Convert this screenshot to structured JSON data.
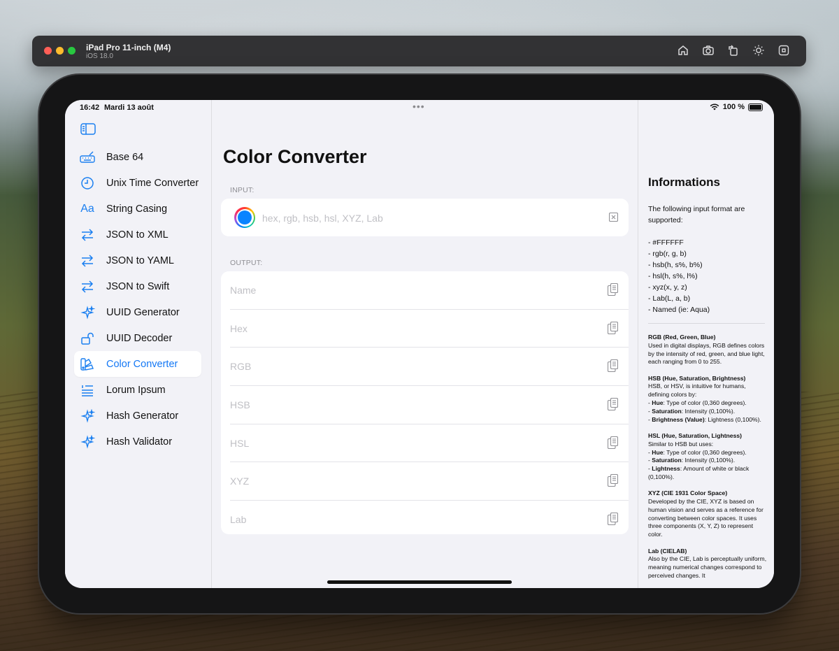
{
  "simulator": {
    "device": "iPad Pro 11-inch (M4)",
    "os": "iOS 18.0",
    "tools": [
      "home-icon",
      "screenshot-icon",
      "rotate-icon",
      "appearance-icon",
      "command-icon"
    ]
  },
  "status_bar": {
    "time": "16:42",
    "date": "Mardi 13 août",
    "battery": "100 %",
    "dots": "•••"
  },
  "sidebar": {
    "items": [
      {
        "label": "Base 64",
        "icon": "keyboard-icon",
        "active": false
      },
      {
        "label": "Unix Time Converter",
        "icon": "clock-icon",
        "active": false
      },
      {
        "label": "String Casing",
        "icon": "text-case-icon",
        "active": false
      },
      {
        "label": "JSON to XML",
        "icon": "arrows-swap-icon",
        "active": false
      },
      {
        "label": "JSON to YAML",
        "icon": "arrows-swap-icon",
        "active": false
      },
      {
        "label": "JSON to Swift",
        "icon": "arrows-swap-icon",
        "active": false
      },
      {
        "label": "UUID Generator",
        "icon": "sparkles-icon",
        "active": false
      },
      {
        "label": "UUID Decoder",
        "icon": "unlock-icon",
        "active": false
      },
      {
        "label": "Color Converter",
        "icon": "swatch-icon",
        "active": true
      },
      {
        "label": "Lorum Ipsum",
        "icon": "text-quote-icon",
        "active": false
      },
      {
        "label": "Hash Generator",
        "icon": "sparkles-icon",
        "active": false
      },
      {
        "label": "Hash Validator",
        "icon": "sparkles-icon",
        "active": false
      }
    ]
  },
  "main": {
    "title": "Color Converter",
    "input_label": "INPUT:",
    "input_placeholder": "hex, rgb, hsb, hsl, XYZ, Lab",
    "input_value": "",
    "output_label": "OUTPUT:",
    "outputs": [
      "Name",
      "Hex",
      "RGB",
      "HSB",
      "HSL",
      "XYZ",
      "Lab"
    ]
  },
  "info": {
    "title": "Informations",
    "intro": "The following input format are supported:",
    "formats": [
      "- #FFFFFF",
      "- rgb(r, g, b)",
      "- hsb(h, s%, b%)",
      "- hsl(h, s%, l%)",
      "- xyz(x, y, z)",
      "- Lab(L, a, b)",
      "- Named (ie: Aqua)"
    ],
    "rgb": {
      "heading": "RGB (Red, Green, Blue)",
      "text": "Used in digital displays, RGB defines colors by the intensity of red, green, and blue light, each ranging from 0 to 255."
    },
    "hsb": {
      "heading": "HSB (Hue, Saturation, Brightness)",
      "text": "HSB, or HSV, is intuitive for humans, defining colors by:",
      "b1k": "Hue",
      "b1v": ": Type of color (0,360 degrees).",
      "b2k": "Saturation",
      "b2v": ": Intensity (0,100%).",
      "b3k": "Brightness (Value)",
      "b3v": ": Lightness (0,100%)."
    },
    "hsl": {
      "heading": "HSL (Hue, Saturation, Lightness)",
      "text": "Similar to HSB but uses:",
      "b1k": "Hue",
      "b1v": ": Type of color (0,360 degrees).",
      "b2k": "Saturation",
      "b2v": ": Intensity (0,100%).",
      "b3k": "Lightness",
      "b3v": ": Amount of white or black (0,100%)."
    },
    "xyz": {
      "heading": "XYZ (CIE 1931 Color Space)",
      "text": "Developed by the CIE, XYZ is based on human vision and serves as a reference for converting between color spaces. It uses three components (X, Y, Z) to represent color."
    },
    "lab": {
      "heading": "Lab (CIELAB)",
      "text": "Also by the CIE, Lab is perceptually uniform, meaning numerical changes correspond to perceived changes. It"
    }
  }
}
